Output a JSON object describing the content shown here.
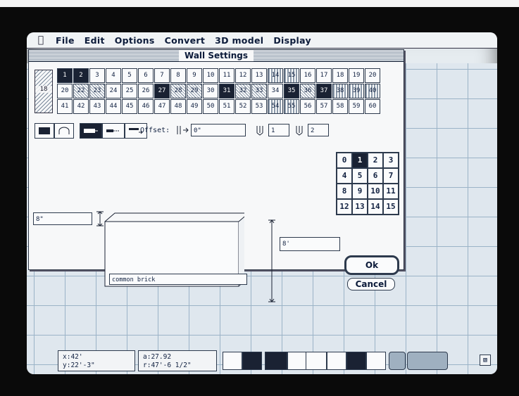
{
  "menubar": {
    "apple_icon": "apple-icon",
    "items": [
      "File",
      "Edit",
      "Options",
      "Convert",
      "3D model",
      "Display"
    ]
  },
  "dialog": {
    "title": "Wall Settings",
    "current_pattern": "18",
    "patterns_row1": [
      "1",
      "2",
      "3",
      "4",
      "5",
      "6",
      "7",
      "8",
      "9",
      "10",
      "11",
      "12",
      "13",
      "14",
      "15",
      "16",
      "17",
      "18",
      "19",
      "20"
    ],
    "patterns_row2": [
      "20",
      "22",
      "23",
      "24",
      "25",
      "26",
      "27",
      "28",
      "29",
      "30",
      "31",
      "32",
      "33",
      "34",
      "35",
      "36",
      "37",
      "38",
      "39",
      "40"
    ],
    "patterns_row3": [
      "41",
      "42",
      "43",
      "44",
      "45",
      "46",
      "47",
      "48",
      "49",
      "50",
      "51",
      "52",
      "53",
      "54",
      "55",
      "56",
      "57",
      "58",
      "59",
      "60"
    ],
    "offset_label": "Offset:",
    "offset_value": "0\"",
    "layer_count_a": "1",
    "layer_count_b": "2",
    "number_grid": [
      "0",
      "1",
      "2",
      "3",
      "4",
      "5",
      "6",
      "7",
      "8",
      "9",
      "10",
      "11",
      "12",
      "13",
      "14",
      "15"
    ],
    "selected_number": "1",
    "thickness_value": "8\"",
    "height_value": "8'",
    "material_name": "common brick",
    "ok_label": "Ok",
    "cancel_label": "Cancel"
  },
  "status": {
    "x": "x:42'",
    "y": "y:22'-3\"",
    "angle": "a:27.92",
    "radius": "r:47'-6 1/2\""
  },
  "colors": {
    "accent": "#1a2233",
    "grid_line": "#9bb3c7",
    "background": "#dfe7ee"
  }
}
